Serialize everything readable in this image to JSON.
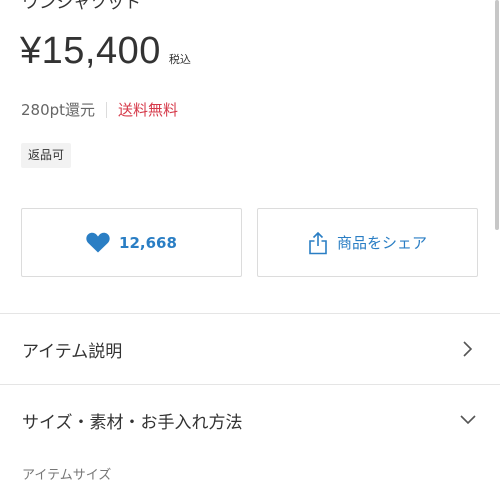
{
  "product": {
    "title_partial": "ワンシャツット",
    "price": "¥15,400",
    "tax_label": "税込",
    "points": "280pt還元",
    "shipping": "送料無料",
    "badge": "返品可"
  },
  "actions": {
    "like_count": "12,668",
    "share_label": "商品をシェア"
  },
  "sections": [
    {
      "label": "アイテム説明",
      "icon": "chevron-right-icon"
    },
    {
      "label": "サイズ・素材・お手入れ方法",
      "icon": "chevron-down-icon"
    }
  ],
  "subsection": {
    "heading": "アイテムサイズ"
  },
  "colors": {
    "accent": "#2a7ec4",
    "shipping": "#d63a4a",
    "text": "#333333",
    "muted": "#666666"
  }
}
